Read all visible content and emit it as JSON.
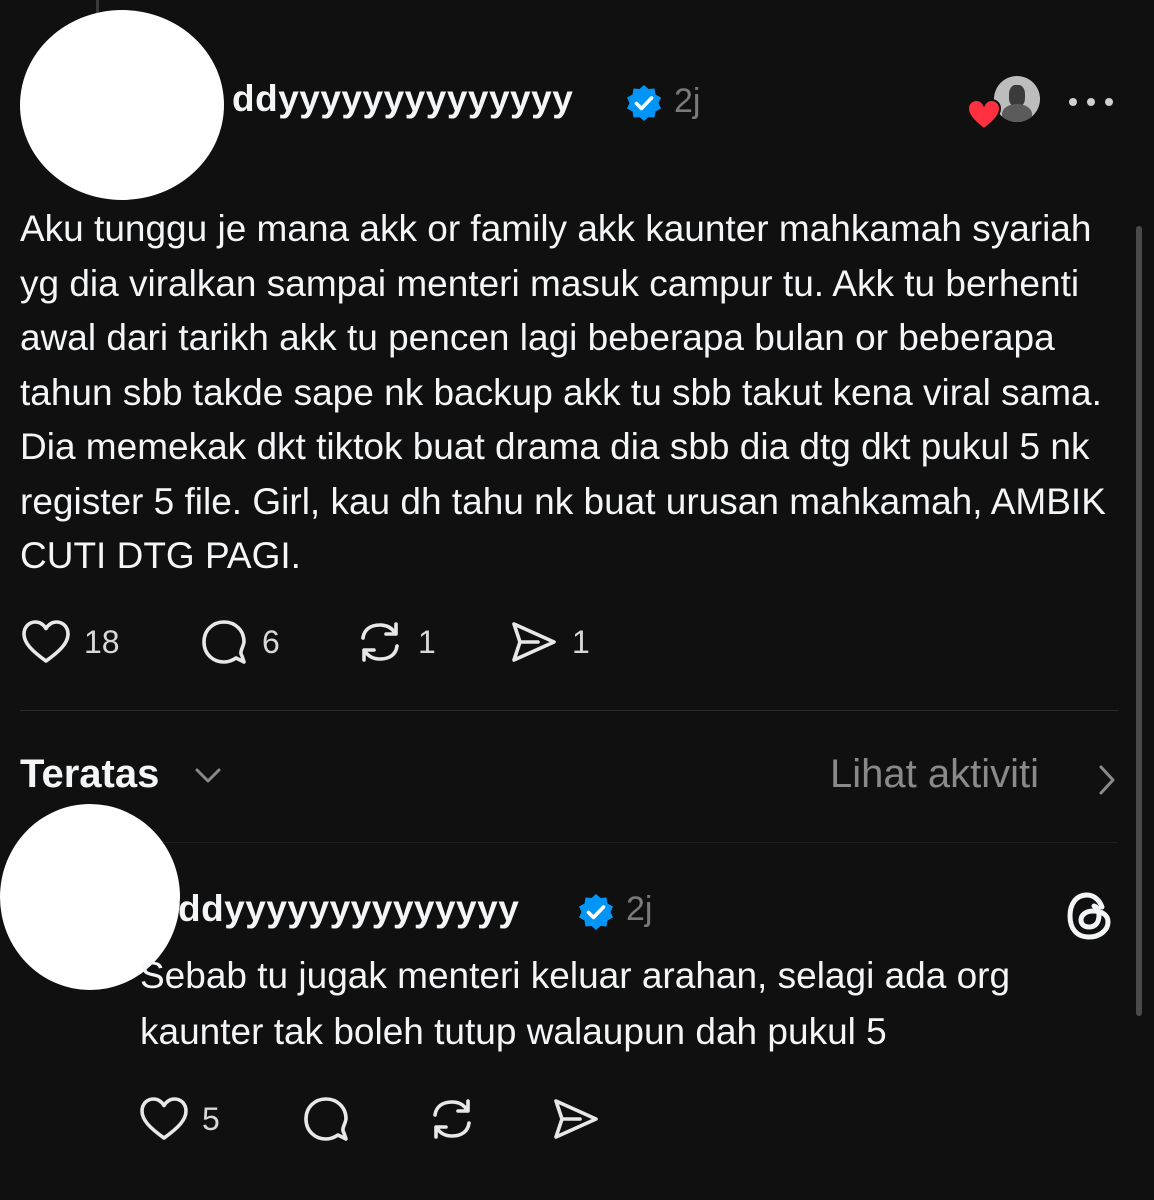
{
  "post": {
    "username": "ddyyyyyyyyyyyyyy",
    "time": "2j",
    "body": "Aku tunggu je mana akk or family akk kaunter mahkamah syariah yg dia viralkan sampai menteri masuk campur tu. Akk tu berhenti awal dari tarikh akk tu pencen lagi beberapa bulan or beberapa tahun sbb takde sape nk backup akk tu sbb takut kena viral sama. Dia memekak dkt tiktok buat drama dia sbb dia dtg dkt pukul 5 nk register 5 file. Girl, kau dh tahu nk buat urusan mahkamah, AMBIK CUTI DTG PAGI.",
    "likes": "18",
    "comments": "6",
    "reposts": "1",
    "shares": "1"
  },
  "sort": {
    "label": "Teratas",
    "activity_link": "Lihat aktiviti"
  },
  "reply": {
    "username": "ddyyyyyyyyyyyyyy",
    "time": "2j",
    "body": "Sebab tu jugak menteri keluar arahan, selagi ada org kaunter tak boleh tutup walaupun dah pukul 5",
    "likes": "5"
  },
  "icons": {
    "verified": "verified-badge-icon",
    "heart": "heart-icon",
    "comment": "comment-icon",
    "repost": "repost-icon",
    "share": "share-icon",
    "more": "more-icon",
    "threads": "threads-logo-icon"
  },
  "colors": {
    "background": "#101010",
    "text": "#f3f5f7",
    "muted": "#7a7a7a",
    "verified": "#0095f6",
    "like_badge": "#ff3040"
  }
}
